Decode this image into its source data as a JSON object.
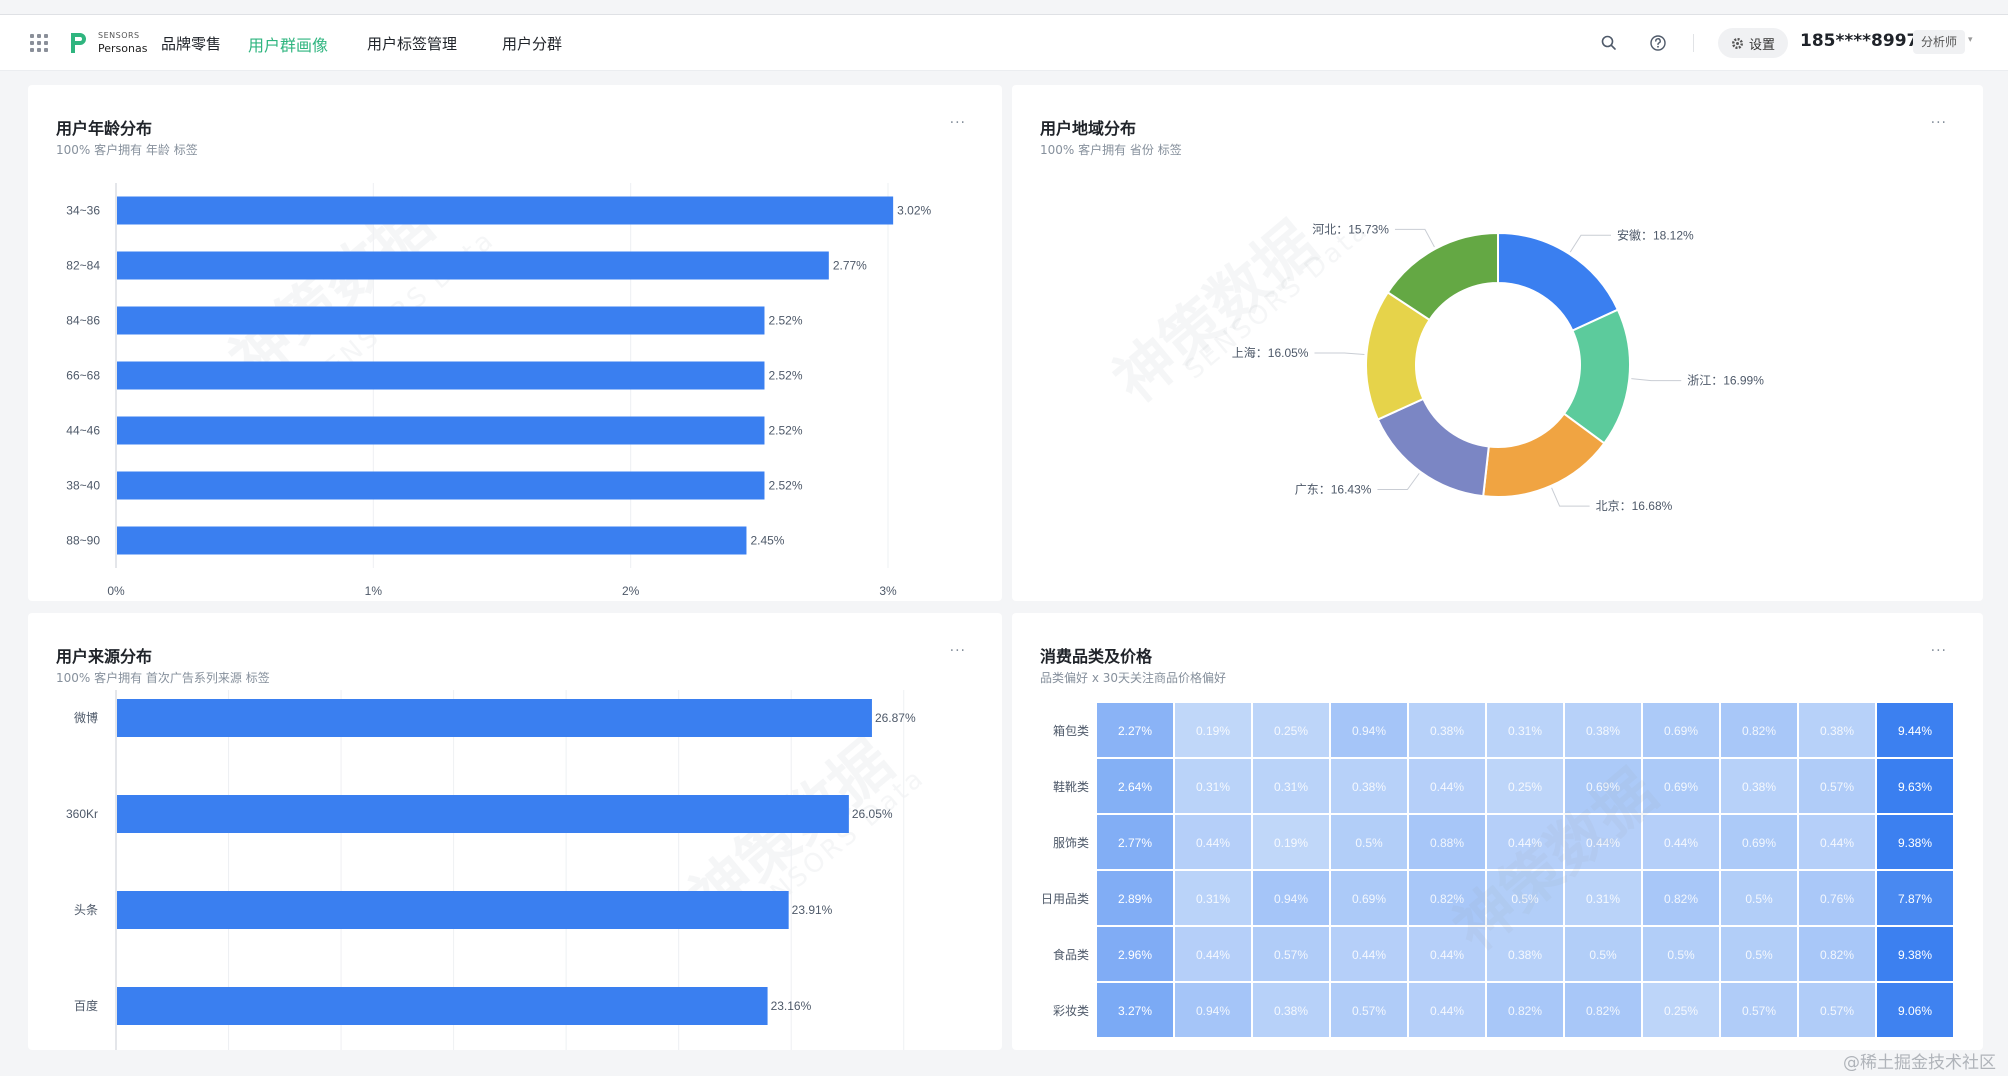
{
  "nav": {
    "logo_top": "SENSORS",
    "logo_bottom": "Personas",
    "items": [
      "品牌零售",
      "用户群画像",
      "用户标签管理",
      "用户分群"
    ],
    "settings_label": "设置",
    "user": "185****8997",
    "role": "分析师"
  },
  "watermark": {
    "main": "神策数据",
    "sub": "SENSORS Data"
  },
  "footer_watermark": "@稀土掘金技术社区",
  "colors": {
    "primary_bar": "#3a7ff0",
    "nav_active": "#2fb57f"
  },
  "cards": {
    "age": {
      "title": "用户年龄分布",
      "subtitle": "100% 客户拥有 年龄 标签",
      "more": "···"
    },
    "region": {
      "title": "用户地域分布",
      "subtitle": "100% 客户拥有 省份 标签",
      "more": "···"
    },
    "source": {
      "title": "用户来源分布",
      "subtitle": "100% 客户拥有 首次广告系列来源 标签",
      "more": "···"
    },
    "consume": {
      "title": "消费品类及价格",
      "subtitle": "品类偏好 x 30天关注商品价格偏好",
      "more": "···"
    }
  },
  "chart_data": [
    {
      "type": "bar",
      "orientation": "horizontal",
      "categories": [
        "34~36",
        "82~84",
        "84~86",
        "66~68",
        "44~46",
        "38~40",
        "88~90"
      ],
      "values": [
        3.02,
        2.77,
        2.52,
        2.52,
        2.52,
        2.52,
        2.45
      ],
      "value_labels": [
        "3.02%",
        "2.77%",
        "2.52%",
        "2.52%",
        "2.52%",
        "2.52%",
        "2.45%"
      ],
      "xticks": [
        "0%",
        "1%",
        "2%",
        "3%"
      ],
      "xlim": [
        0,
        3
      ],
      "grid": true,
      "color": "#3a7ff0"
    },
    {
      "type": "pie",
      "donut": true,
      "labels": [
        "安徽",
        "浙江",
        "北京",
        "广东",
        "上海",
        "河北"
      ],
      "values": [
        18.12,
        16.99,
        16.68,
        16.43,
        16.05,
        15.73
      ],
      "slice_labels": [
        "安徽：18.12%",
        "浙江：16.99%",
        "北京：16.68%",
        "广东：16.43%",
        "上海：16.05%",
        "河北：15.73%"
      ],
      "colors": [
        "#3a7ff0",
        "#5ccb9c",
        "#f0a442",
        "#7b86c4",
        "#e6d34a",
        "#64a844"
      ],
      "legend": "bottom"
    },
    {
      "type": "bar",
      "orientation": "horizontal",
      "categories": [
        "微博",
        "360Kr",
        "头条",
        "百度"
      ],
      "values": [
        26.87,
        26.05,
        23.91,
        23.16
      ],
      "value_labels": [
        "26.87%",
        "26.05%",
        "23.91%",
        "23.16%"
      ],
      "xlim": [
        0,
        30
      ],
      "grid": true,
      "color": "#3a7ff0"
    },
    {
      "type": "heatmap",
      "rows": [
        "箱包类",
        "鞋靴类",
        "服饰类",
        "日用品类",
        "食品类",
        "彩妆类"
      ],
      "values": [
        [
          2.27,
          0.19,
          0.25,
          0.94,
          0.38,
          0.31,
          0.38,
          0.69,
          0.82,
          0.38,
          9.44
        ],
        [
          2.64,
          0.31,
          0.31,
          0.38,
          0.44,
          0.25,
          0.69,
          0.69,
          0.38,
          0.57,
          9.63
        ],
        [
          2.77,
          0.44,
          0.19,
          0.5,
          0.88,
          0.44,
          0.44,
          0.44,
          0.69,
          0.44,
          9.38
        ],
        [
          2.89,
          0.31,
          0.94,
          0.69,
          0.82,
          0.5,
          0.31,
          0.82,
          0.5,
          0.76,
          7.87
        ],
        [
          2.96,
          0.44,
          0.57,
          0.44,
          0.44,
          0.38,
          0.5,
          0.5,
          0.5,
          0.82,
          9.38
        ],
        [
          3.27,
          0.94,
          0.38,
          0.57,
          0.44,
          0.82,
          0.82,
          0.25,
          0.57,
          0.57,
          9.06
        ]
      ],
      "cell_labels": [
        [
          "2.27%",
          "0.19%",
          "0.25%",
          "0.94%",
          "0.38%",
          "0.31%",
          "0.38%",
          "0.69%",
          "0.82%",
          "0.38%",
          "9.44%"
        ],
        [
          "2.64%",
          "0.31%",
          "0.31%",
          "0.38%",
          "0.44%",
          "0.25%",
          "0.69%",
          "0.69%",
          "0.38%",
          "0.57%",
          "9.63%"
        ],
        [
          "2.77%",
          "0.44%",
          "0.19%",
          "0.5%",
          "0.88%",
          "0.44%",
          "0.44%",
          "0.44%",
          "0.69%",
          "0.44%",
          "9.38%"
        ],
        [
          "2.89%",
          "0.31%",
          "0.94%",
          "0.69%",
          "0.82%",
          "0.5%",
          "0.31%",
          "0.82%",
          "0.5%",
          "0.76%",
          "7.87%"
        ],
        [
          "2.96%",
          "0.44%",
          "0.57%",
          "0.44%",
          "0.44%",
          "0.38%",
          "0.5%",
          "0.5%",
          "0.5%",
          "0.82%",
          "9.38%"
        ],
        [
          "3.27%",
          "0.94%",
          "0.38%",
          "0.57%",
          "0.44%",
          "0.82%",
          "0.82%",
          "0.25%",
          "0.57%",
          "0.57%",
          "9.06%"
        ]
      ]
    }
  ]
}
